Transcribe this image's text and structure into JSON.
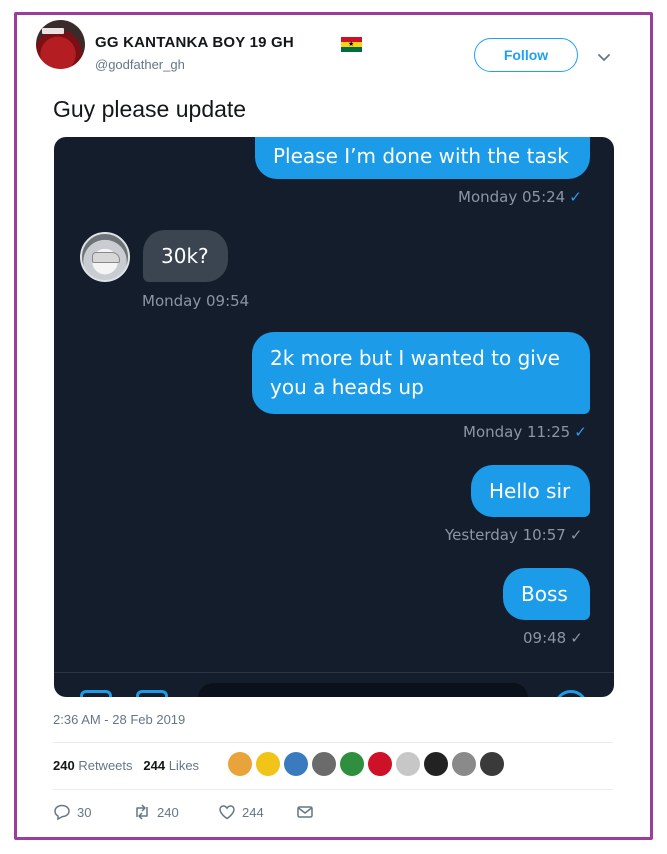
{
  "tweet": {
    "author_name": "GG KANTANKA BOY 19 GH",
    "author_handle": "@godfather_gh",
    "follow_label": "Follow",
    "text": "Guy please update",
    "timestamp": "2:36 AM - 28 Feb 2019",
    "retweets_count": "240",
    "retweets_label": "Retweets",
    "likes_count": "244",
    "likes_label": "Likes",
    "reply_count": "30",
    "retweet_action_count": "240",
    "like_action_count": "244"
  },
  "media": {
    "messages": [
      {
        "direction": "out",
        "text": "Please I’m done with the task",
        "time": "Monday 05:24"
      },
      {
        "direction": "in",
        "text": "30k?",
        "time": "Monday 09:54"
      },
      {
        "direction": "out",
        "text_line1": "2k more  but I wanted to give",
        "text_line2": "you a heads up",
        "time": "Monday 11:25"
      },
      {
        "direction": "out",
        "text": "Hello sir",
        "time": "Yesterday 10:57"
      },
      {
        "direction": "out",
        "text": "Boss",
        "time": "09:48"
      }
    ],
    "read_tick": "✓"
  },
  "colors": {
    "frame": "#9b3d9b",
    "twitter_blue": "#1da1f2",
    "chat_background": "#141d2b",
    "outgoing_bubble": "#1c9ce8",
    "incoming_bubble": "#3b4552"
  },
  "likers": [
    "#e8a33a",
    "#f0c419",
    "#3a7bbf",
    "#6b6b6b",
    "#2f8f3f",
    "#ce1126",
    "#c7c7c7",
    "#222222",
    "#8a8a8a",
    "#3a3a3a"
  ]
}
